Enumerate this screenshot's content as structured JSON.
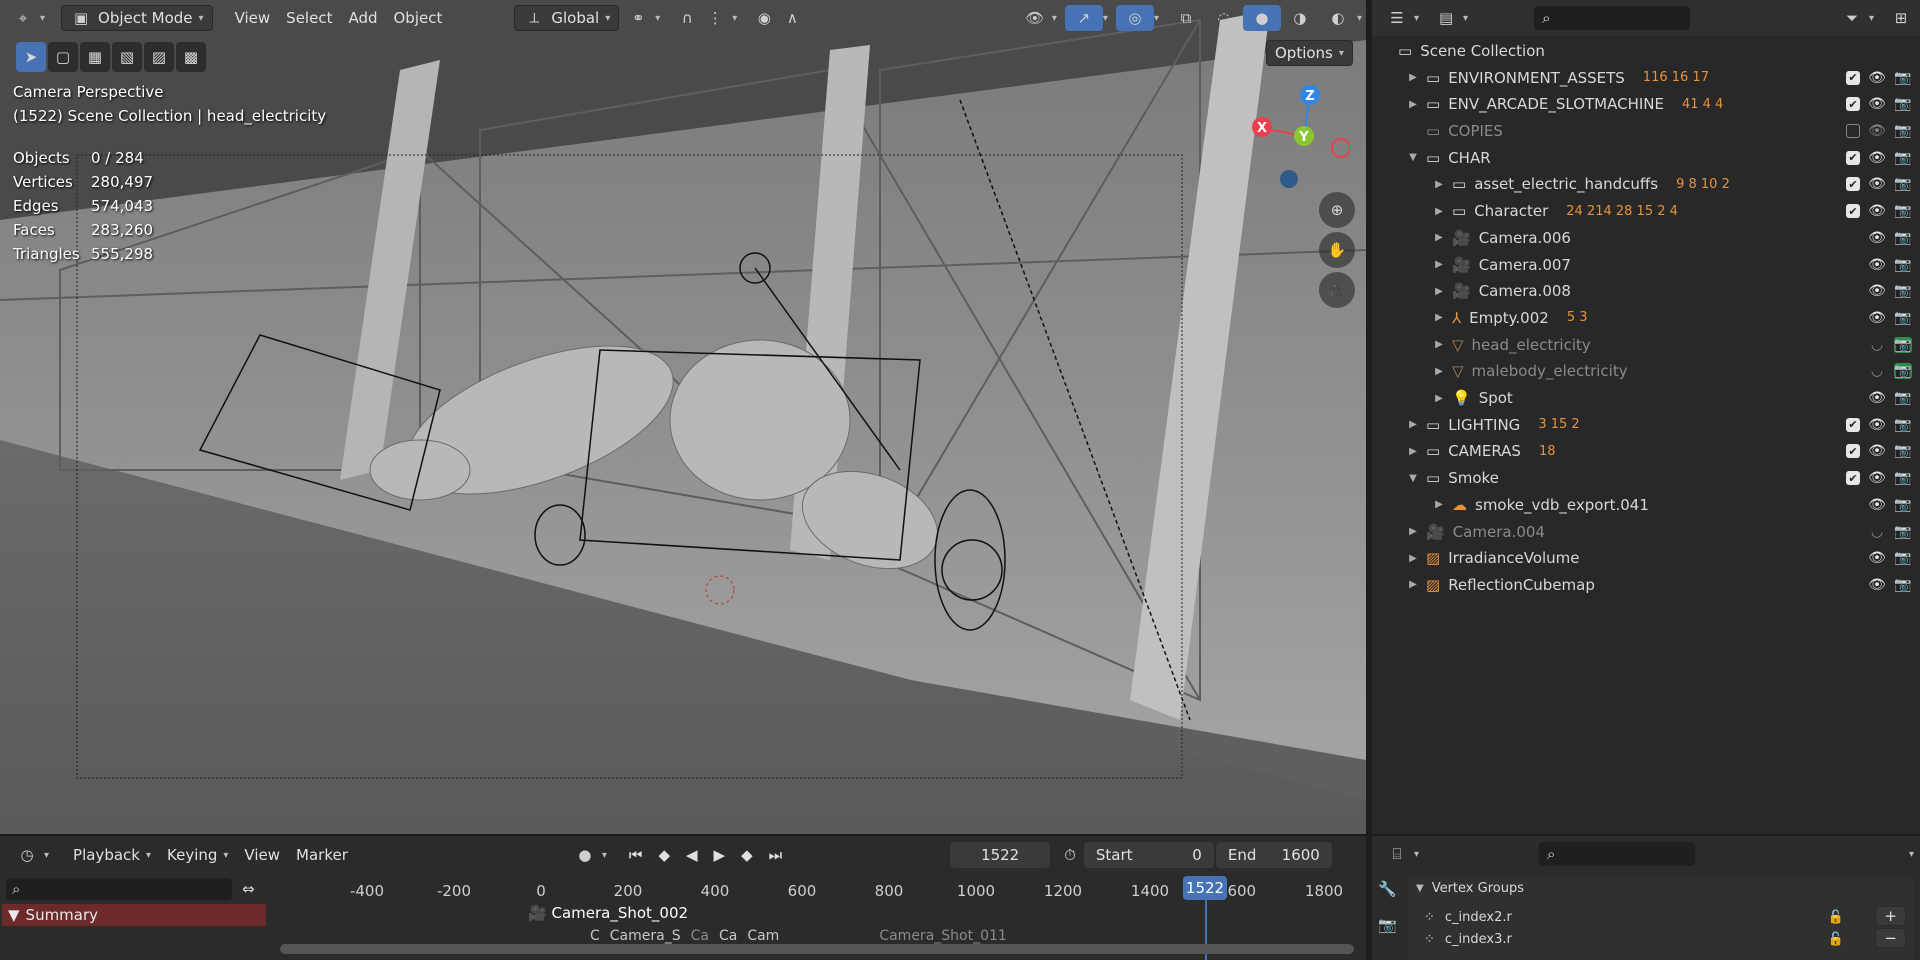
{
  "viewport": {
    "mode": "Object Mode",
    "menu": [
      "View",
      "Select",
      "Add",
      "Object"
    ],
    "transform_orientation": "Global",
    "options_label": "Options",
    "perspective": "Camera Perspective",
    "context": "(1522) Scene Collection | head_electricity",
    "stats": [
      {
        "key": "Objects",
        "value": "0 / 284"
      },
      {
        "key": "Vertices",
        "value": "280,497"
      },
      {
        "key": "Edges",
        "value": "574,043"
      },
      {
        "key": "Faces",
        "value": "283,260"
      },
      {
        "key": "Triangles",
        "value": "555,298"
      }
    ],
    "gizmo": {
      "x": "X",
      "y": "Y",
      "z": "Z"
    },
    "colors": {
      "x": "#e8404c",
      "y": "#8ac630",
      "z": "#2f86e6"
    }
  },
  "outliner": {
    "root": "Scene Collection",
    "rows": [
      {
        "label": "ENVIRONMENT_ASSETS",
        "counts": "116 16 17"
      },
      {
        "label": "ENV_ARCADE_SLOTMACHINE",
        "counts": "41 4 4"
      },
      {
        "label": "COPIES",
        "counts": ""
      },
      {
        "label": "CHAR",
        "counts": ""
      },
      {
        "label": "asset_electric_handcuffs",
        "counts": "9 8 10 2"
      },
      {
        "label": "Character",
        "counts": "24 214 28 15 2 4"
      },
      {
        "label": "Camera.006",
        "counts": ""
      },
      {
        "label": "Camera.007",
        "counts": ""
      },
      {
        "label": "Camera.008",
        "counts": ""
      },
      {
        "label": "Empty.002",
        "counts": "5 3"
      },
      {
        "label": "head_electricity",
        "counts": ""
      },
      {
        "label": "malebody_electricity",
        "counts": ""
      },
      {
        "label": "Spot",
        "counts": ""
      },
      {
        "label": "LIGHTING",
        "counts": "3 15 2"
      },
      {
        "label": "CAMERAS",
        "counts": "18"
      },
      {
        "label": "Smoke",
        "counts": ""
      },
      {
        "label": "smoke_vdb_export.041",
        "counts": ""
      },
      {
        "label": "Camera.004",
        "counts": ""
      },
      {
        "label": "IrradianceVolume",
        "counts": ""
      },
      {
        "label": "ReflectionCubemap",
        "counts": ""
      }
    ]
  },
  "timeline": {
    "menu": [
      "Playback",
      "Keying",
      "View",
      "Marker"
    ],
    "current_frame": "1522",
    "start_label": "Start",
    "start_value": "0",
    "end_label": "End",
    "end_value": "1600",
    "ticks": [
      "-400",
      "-200",
      "0",
      "200",
      "400",
      "600",
      "800",
      "1000",
      "1200",
      "1400",
      "1600",
      "1800"
    ],
    "summary": "Summary",
    "markers": [
      "Camera_Shot_002",
      "C",
      "Camera_S",
      "Ca",
      "Ca",
      "Cam",
      "Camera_Shot_011"
    ]
  },
  "properties": {
    "section": "Vertex Groups",
    "groups": [
      "c_index2.r",
      "c_index3.r"
    ]
  }
}
